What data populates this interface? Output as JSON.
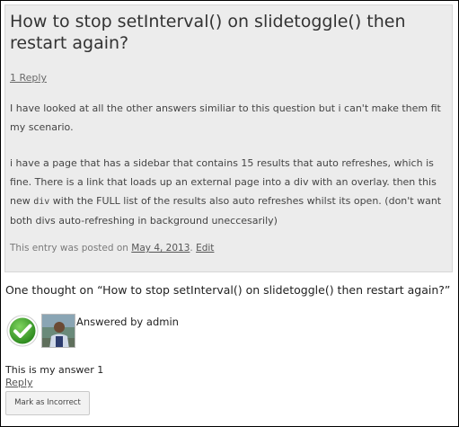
{
  "post": {
    "title": "How to stop setInterval() on slidetoggle() then restart again?",
    "reply_count": "1 Reply",
    "para1": "I have looked at all the other answers similiar to this question but i can't make them fit my scenario.",
    "para2_before_code": "i have a page that has a sidebar that contains 15 results that auto refreshes, which is fine. There is a link that loads up an external page into a div with an overlay. then this new ",
    "para2_code": "div",
    "para2_after_code": " with the FULL list of the results also auto refreshes whilst its open. (don't want both divs auto-refreshing in background uneccesarily)",
    "meta_prefix": "This entry was posted on ",
    "date": "May 4, 2013",
    "meta_sep": ". ",
    "edit": "Edit"
  },
  "comments": {
    "title": "One thought on “How to stop setInterval() on slidetoggle() then restart again?”",
    "items": [
      {
        "answered_by": "Answered by admin",
        "text": "This is my answer 1",
        "reply": "Reply",
        "mark_button": "Mark as Incorrect"
      }
    ]
  },
  "colors": {
    "post_background": "#ececec",
    "check_green": "#3a9a2a"
  },
  "icons": [
    "checkmark-icon",
    "avatar"
  ]
}
